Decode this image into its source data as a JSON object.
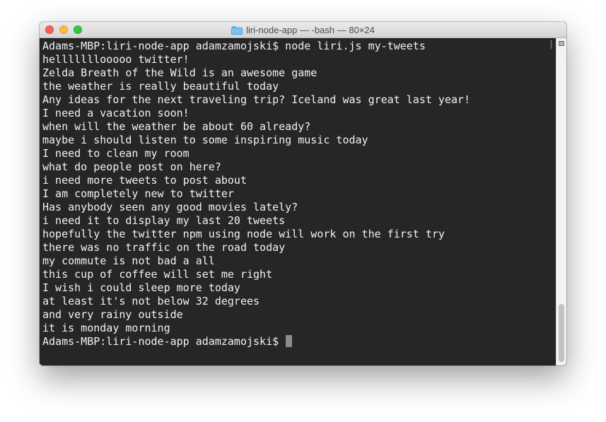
{
  "window": {
    "title": "liri-node-app — -bash — 80×24",
    "icons": {
      "folder": "folder-icon",
      "split": "split-pane-icon"
    },
    "colors": {
      "terminal_background": "#262626",
      "terminal_text": "#f2f2f2",
      "close": "#fc605c",
      "minimize": "#fdbc40",
      "zoom": "#34c84a"
    }
  },
  "terminal": {
    "lines": [
      "Adams-MBP:liri-node-app adamzamojski$ node liri.js my-tweets",
      "helllllllooooo twitter!",
      "Zelda Breath of the Wild is an awesome game",
      "the weather is really beautiful today",
      "Any ideas for the next traveling trip? Iceland was great last year!",
      "I need a vacation soon!",
      "when will the weather be about 60 already?",
      "maybe i should listen to some inspiring music today",
      "I need to clean my room",
      "what do people post on here?",
      "i need more tweets to post about",
      "I am completely new to twitter",
      "Has anybody seen any good movies lately?",
      "i need it to display my last 20 tweets",
      "hopefully the twitter npm using node will work on the first try",
      "there was no traffic on the road today",
      "my commute is not bad a all",
      "this cup of coffee will set me right",
      "I wish i could sleep more today",
      "at least it's not below 32 degrees",
      "and very rainy outside",
      "it is monday morning"
    ],
    "prompt": "Adams-MBP:liri-node-app adamzamojski$ "
  }
}
